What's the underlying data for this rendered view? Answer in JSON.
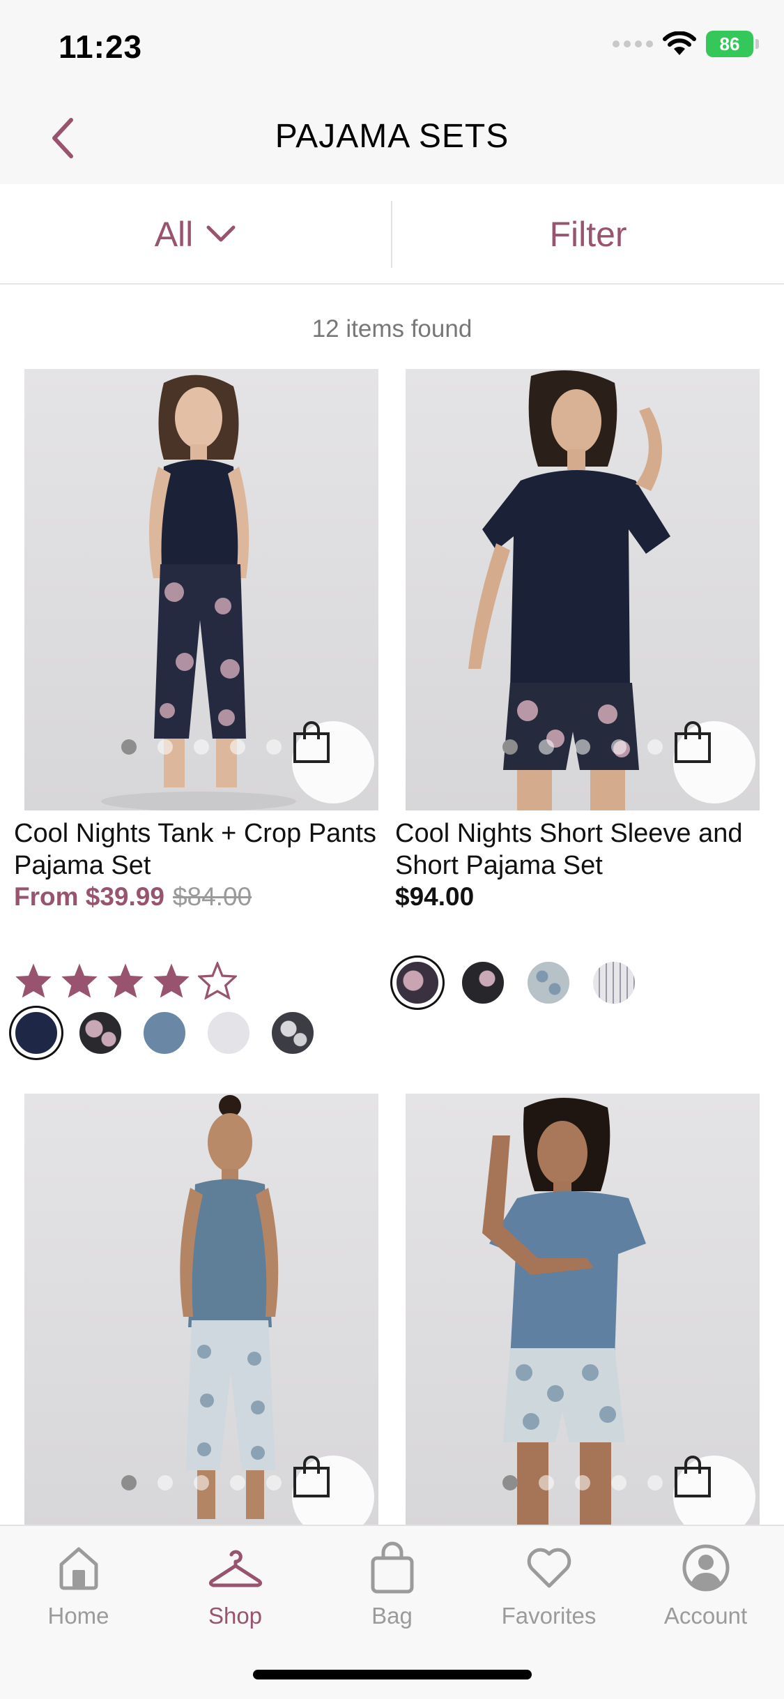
{
  "status_bar": {
    "time": "11:23",
    "battery": "86"
  },
  "header": {
    "title": "PAJAMA SETS"
  },
  "filters": {
    "category_label": "All",
    "filter_label": "Filter"
  },
  "results": {
    "count_text": "12 items found"
  },
  "products": [
    {
      "name": "Cool Nights Tank + Crop Pants Pajama Set",
      "price_prefix": "From $39.99",
      "original_price": "$84.00",
      "rating": 4,
      "rating_max": 5,
      "swatch_colors": [
        "#1e2745",
        "#2a2a2e",
        "#6a87a6",
        "#e4e3e8",
        "#3c3c44"
      ]
    },
    {
      "name": "Cool Nights Short Sleeve and Short Pajama Set",
      "price": "$94.00",
      "swatch_colors": [
        "#3a3140",
        "#26262b",
        "#b7c1c8",
        "#e6e6ea"
      ]
    },
    {
      "name": "",
      "price": ""
    },
    {
      "name": "",
      "price": ""
    }
  ],
  "colors": {
    "accent": "#98536e",
    "star": "#98536e",
    "navy": "#1b2238"
  },
  "tab_bar": {
    "items": [
      {
        "label": "Home",
        "icon": "home-icon"
      },
      {
        "label": "Shop",
        "icon": "hanger-icon",
        "active": true
      },
      {
        "label": "Bag",
        "icon": "bag-icon"
      },
      {
        "label": "Favorites",
        "icon": "heart-icon"
      },
      {
        "label": "Account",
        "icon": "account-icon"
      }
    ]
  }
}
